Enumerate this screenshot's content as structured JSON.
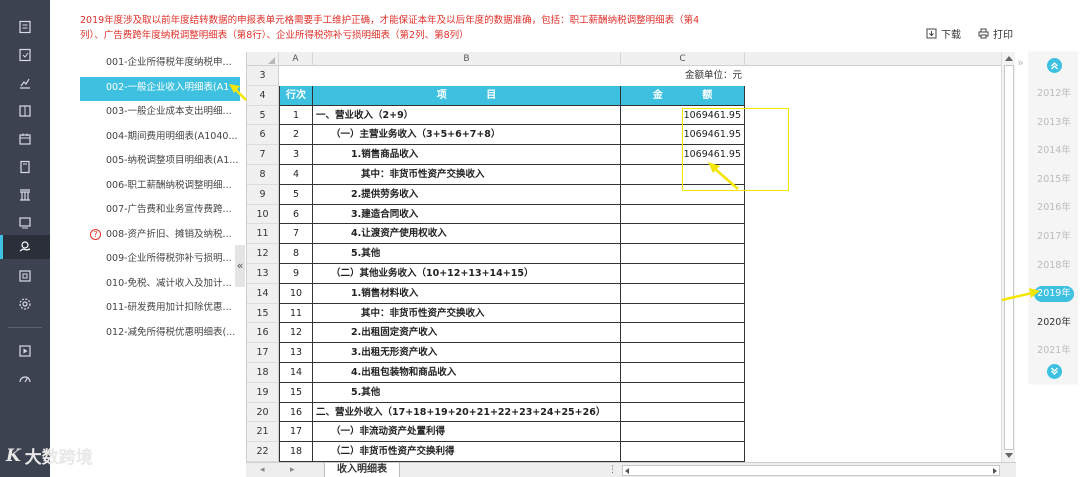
{
  "notice": "2019年度涉及取以前年度结转数据的申报表单元格需要手工维护正确，才能保证本年及以后年度的数据准确，包括：职工薪酬纳税调整明细表（第4列）、广告费跨年度纳税调整明细表（第8行）、企业所得税弥补亏损明细表（第2列、第8列）",
  "toolbar": {
    "download": "下载",
    "print": "打印"
  },
  "sidebar": {
    "items": [
      {
        "label": "001-企业所得税年度纳税申..."
      },
      {
        "label": "002-一般企业收入明细表(A1"
      },
      {
        "label": "003-一般企业成本支出明细..."
      },
      {
        "label": "004-期间费用明细表(A1040..."
      },
      {
        "label": "005-纳税调整项目明细表(A1..."
      },
      {
        "label": "006-职工薪酬纳税调整明细..."
      },
      {
        "label": "007-广告费和业务宣传费跨..."
      },
      {
        "label": "008-资产折旧、摊销及纳税..."
      },
      {
        "label": "009-企业所得税弥补亏损明..."
      },
      {
        "label": "010-免税、减计收入及加计..."
      },
      {
        "label": "011-研发费用加计扣除优惠..."
      },
      {
        "label": "012-减免所得税优惠明细表(..."
      }
    ],
    "warn_glyph": "?"
  },
  "collapse": "«",
  "sheet": {
    "col_headers": {
      "A": "A",
      "B": "B",
      "C": "C"
    },
    "unit_label": "金额单位：元",
    "head": {
      "rownum": "4",
      "a": "行次",
      "b": "项 目",
      "c": "金 额"
    },
    "rows": [
      {
        "n": "5",
        "a": "1",
        "b": "一、营业收入（2+9）",
        "c": "1069461.95",
        "lvl": 0
      },
      {
        "n": "6",
        "a": "2",
        "b": "（一）主营业务收入（3+5+6+7+8）",
        "c": "1069461.95",
        "lvl": 1
      },
      {
        "n": "7",
        "a": "3",
        "b": "1.销售商品收入",
        "c": "1069461.95",
        "lvl": 2
      },
      {
        "n": "8",
        "a": "4",
        "b": "其中：非货币性资产交换收入",
        "c": "",
        "lvl": 3
      },
      {
        "n": "9",
        "a": "5",
        "b": "2.提供劳务收入",
        "c": "",
        "lvl": 2
      },
      {
        "n": "10",
        "a": "6",
        "b": "3.建造合同收入",
        "c": "",
        "lvl": 2
      },
      {
        "n": "11",
        "a": "7",
        "b": "4.让渡资产使用权收入",
        "c": "",
        "lvl": 2
      },
      {
        "n": "12",
        "a": "8",
        "b": "5.其他",
        "c": "",
        "lvl": 2
      },
      {
        "n": "13",
        "a": "9",
        "b": "（二）其他业务收入（10+12+13+14+15）",
        "c": "",
        "lvl": 1
      },
      {
        "n": "14",
        "a": "10",
        "b": "1.销售材料收入",
        "c": "",
        "lvl": 2
      },
      {
        "n": "15",
        "a": "11",
        "b": "其中：非货币性资产交换收入",
        "c": "",
        "lvl": 3
      },
      {
        "n": "16",
        "a": "12",
        "b": "2.出租固定资产收入",
        "c": "",
        "lvl": 2
      },
      {
        "n": "17",
        "a": "13",
        "b": "3.出租无形资产收入",
        "c": "",
        "lvl": 2
      },
      {
        "n": "18",
        "a": "14",
        "b": "4.出租包装物和商品收入",
        "c": "",
        "lvl": 2
      },
      {
        "n": "19",
        "a": "15",
        "b": "5.其他",
        "c": "",
        "lvl": 2
      },
      {
        "n": "20",
        "a": "16",
        "b": "二、营业外收入（17+18+19+20+21+22+23+24+25+26）",
        "c": "",
        "lvl": 0
      },
      {
        "n": "21",
        "a": "17",
        "b": "（一）非流动资产处置利得",
        "c": "",
        "lvl": 1
      },
      {
        "n": "22",
        "a": "18",
        "b": "（二）非货币性资产交换利得",
        "c": "",
        "lvl": 1
      }
    ],
    "row3": "3"
  },
  "tabs": {
    "active": "收入明细表",
    "nav_prev": "◂",
    "nav_next": "▸",
    "menu": "⋮"
  },
  "years": {
    "list": [
      "2012年",
      "2013年",
      "2014年",
      "2015年",
      "2016年",
      "2017年",
      "2018年",
      "2019年",
      "2020年",
      "2021年"
    ],
    "selected": "2019年",
    "panel_toggle": "»"
  },
  "watermark": {
    "logo": "K",
    "text": "大数跨境"
  },
  "colors": {
    "accent": "#3ec1e0",
    "rail": "#3c4250",
    "notice": "#e0302a",
    "annotation": "#f5e600"
  },
  "rail_icons": [
    "report-icon",
    "declare-icon",
    "chart-icon",
    "ledger-icon",
    "calendar-icon",
    "book-icon",
    "building-icon",
    "monitor-icon",
    "hand-coin-icon",
    "document-icon",
    "settings-icon",
    "play-icon",
    "gauge-icon"
  ]
}
